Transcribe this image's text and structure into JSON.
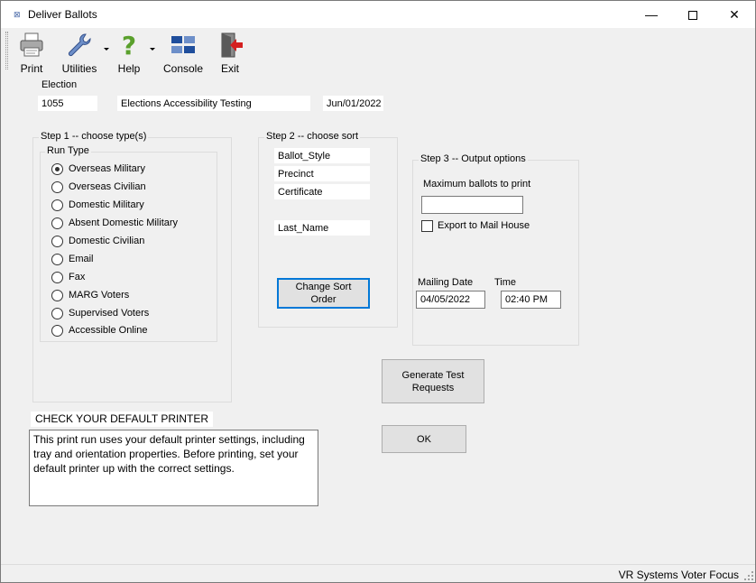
{
  "window": {
    "title": "Deliver Ballots",
    "minimize": "—",
    "close": "✕"
  },
  "toolbar": {
    "items": [
      {
        "label": "Print",
        "icon": "printer-icon"
      },
      {
        "label": "Utilities",
        "icon": "wrench-icon"
      },
      {
        "label": "Help",
        "icon": "question-icon"
      },
      {
        "label": "Console",
        "icon": "console-icon"
      },
      {
        "label": "Exit",
        "icon": "exit-door-icon"
      }
    ]
  },
  "election": {
    "label": "Election",
    "number": "1055",
    "name": "Elections Accessibility Testing",
    "date": "Jun/01/2022"
  },
  "step1": {
    "title": "Step 1 -- choose type(s)",
    "run_type_label": "Run Type",
    "options": [
      {
        "label": "Overseas Military",
        "selected": true
      },
      {
        "label": "Overseas Civilian",
        "selected": false
      },
      {
        "label": "Domestic Military",
        "selected": false
      },
      {
        "label": "Absent Domestic Military",
        "selected": false
      },
      {
        "label": "Domestic Civilian",
        "selected": false
      },
      {
        "label": "Email",
        "selected": false
      },
      {
        "label": "Fax",
        "selected": false
      },
      {
        "label": "MARG Voters",
        "selected": false
      },
      {
        "label": "Supervised Voters",
        "selected": false
      },
      {
        "label": "Accessible Online",
        "selected": false
      }
    ]
  },
  "step2": {
    "title": "Step 2 -- choose sort",
    "sort_fields": [
      "Ballot_Style",
      "Precinct",
      "Certificate",
      "",
      "Last_Name"
    ],
    "change_sort_button": "Change Sort Order"
  },
  "step3": {
    "title": "Step 3 -- Output options",
    "max_ballots_label": "Maximum ballots to print",
    "max_ballots_value": "",
    "export_label": "Export to Mail House",
    "export_checked": false,
    "mailing_date_label": "Mailing Date",
    "mailing_date_value": "04/05/2022",
    "time_label": "Time",
    "time_value": "02:40 PM"
  },
  "buttons": {
    "generate_test": "Generate Test Requests",
    "ok": "OK"
  },
  "notice": {
    "title": "CHECK YOUR DEFAULT PRINTER",
    "body": "This print run uses your default printer settings, including tray and orientation properties.  Before printing, set your default printer up with the correct settings."
  },
  "status": {
    "text": "VR Systems Voter Focus"
  },
  "colors": {
    "accent": "#0078d7",
    "help_green": "#5aa02c",
    "console_blue": "#1f4e9c",
    "exit_red": "#d42020"
  }
}
